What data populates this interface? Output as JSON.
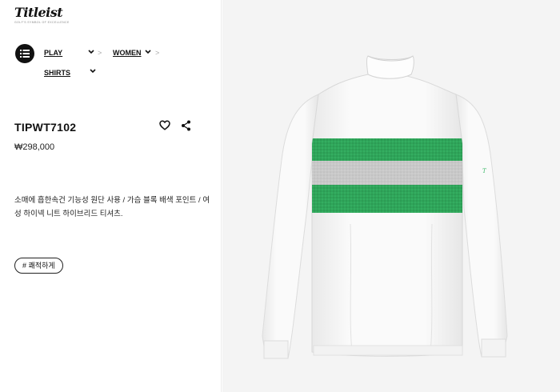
{
  "brand": {
    "logo_text": "Titleist",
    "tagline": "Golf's Symbol of Excellence"
  },
  "breadcrumb": {
    "items": [
      {
        "label": "PLAY"
      },
      {
        "label": "WOMEN"
      },
      {
        "label": "SHIRTS"
      }
    ],
    "separator": ">",
    "caret": "⌄"
  },
  "product": {
    "code": "TIPWT7102",
    "price": "₩298,000",
    "description": "소매에 흡한속건 기능성 원단 사용 / 가슴 블록 배색 포인트 / 여성 하이넥 니트 하이브리드 티셔츠.",
    "tag": "# 쾌적하게"
  },
  "colors": {
    "accent_green": "#2fa55a",
    "stripe_gray": "#c6c6c6",
    "shirt_white": "#fbfbfb",
    "panel_bg": "#f4f4f4"
  },
  "icons": {
    "menu": "menu-icon",
    "wishlist": "heart-icon",
    "share": "share-icon"
  }
}
